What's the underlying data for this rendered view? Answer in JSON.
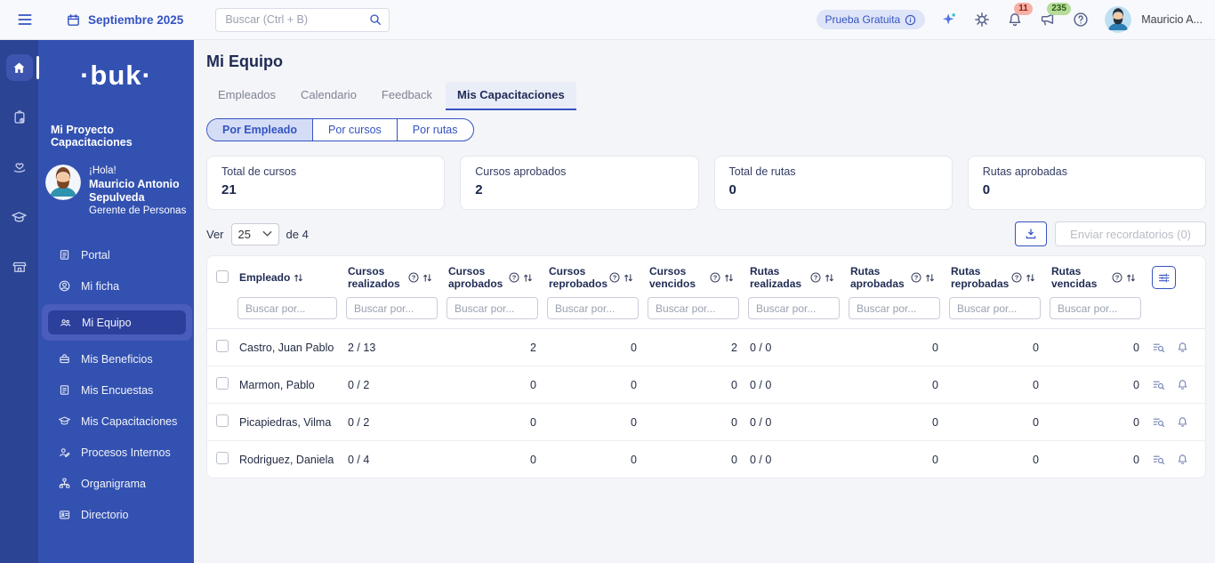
{
  "topbar": {
    "date_label": "Septiembre 2025",
    "search_placeholder": "Buscar (Ctrl + B)",
    "trial_label": "Prueba Gratuita",
    "notifications_badge": "11",
    "announcements_badge": "235",
    "user_name": "Mauricio A..."
  },
  "iconstrip": {
    "items": [
      {
        "icon": "home",
        "active": true
      },
      {
        "icon": "clipboard-tasks"
      },
      {
        "icon": "hand-heart"
      },
      {
        "icon": "graduation-cap"
      },
      {
        "icon": "storefront"
      }
    ]
  },
  "sidebar": {
    "logo_text": "·buk·",
    "project_title": "Mi Proyecto Capacitaciones",
    "greeting": "¡Hola!",
    "user_name": "Mauricio Antonio Sepulveda",
    "user_role": "Gerente de Personas",
    "items": [
      {
        "label": "Portal",
        "icon": "document"
      },
      {
        "label": "Mi ficha",
        "icon": "user-circle"
      },
      {
        "label": "Mi Equipo",
        "icon": "users",
        "active": true
      },
      {
        "label": "Mis Beneficios",
        "icon": "lunchbox"
      },
      {
        "label": "Mis Encuestas",
        "icon": "survey-document"
      },
      {
        "label": "Mis Capacitaciones",
        "icon": "graduation-cap"
      },
      {
        "label": "Procesos Internos",
        "icon": "user-edit"
      },
      {
        "label": "Organigrama",
        "icon": "org-chart"
      },
      {
        "label": "Directorio",
        "icon": "id-card"
      }
    ]
  },
  "main": {
    "title": "Mi Equipo",
    "tabs": [
      {
        "label": "Empleados"
      },
      {
        "label": "Calendario"
      },
      {
        "label": "Feedback"
      },
      {
        "label": "Mis Capacitaciones",
        "active": true
      }
    ],
    "view_pills": [
      {
        "label": "Por Empleado",
        "active": true
      },
      {
        "label": "Por cursos"
      },
      {
        "label": "Por rutas"
      }
    ],
    "summary_cards": [
      {
        "label": "Total de cursos",
        "value": "21"
      },
      {
        "label": "Cursos aprobados",
        "value": "2"
      },
      {
        "label": "Total de rutas",
        "value": "0"
      },
      {
        "label": "Rutas aprobadas",
        "value": "0"
      }
    ],
    "pagination": {
      "ver_label": "Ver",
      "page_size": "25",
      "total_label": "de 4"
    },
    "toolbar": {
      "send_reminders_label": "Enviar recordatorios (0)"
    },
    "table": {
      "filter_placeholder": "Buscar por...",
      "columns": [
        {
          "label": "Empleado"
        },
        {
          "label": "Cursos realizados"
        },
        {
          "label": "Cursos aprobados"
        },
        {
          "label": "Cursos reprobados"
        },
        {
          "label": "Cursos vencidos"
        },
        {
          "label": "Rutas realizadas"
        },
        {
          "label": "Rutas aprobadas"
        },
        {
          "label": "Rutas reprobadas"
        },
        {
          "label": "Rutas vencidas"
        }
      ],
      "rows": [
        {
          "name": "Castro, Juan Pablo",
          "cursos_realizados": "2 / 13",
          "cursos_aprobados": "2",
          "cursos_reprobados": "0",
          "cursos_vencidos": "2",
          "rutas_realizadas": "0 / 0",
          "rutas_aprobadas": "0",
          "rutas_reprobadas": "0",
          "rutas_vencidas": "0"
        },
        {
          "name": "Marmon, Pablo",
          "cursos_realizados": "0 / 2",
          "cursos_aprobados": "0",
          "cursos_reprobados": "0",
          "cursos_vencidos": "0",
          "rutas_realizadas": "0 / 0",
          "rutas_aprobadas": "0",
          "rutas_reprobadas": "0",
          "rutas_vencidas": "0"
        },
        {
          "name": "Picapiedras, Vilma",
          "cursos_realizados": "0 / 2",
          "cursos_aprobados": "0",
          "cursos_reprobados": "0",
          "cursos_vencidos": "0",
          "rutas_realizadas": "0 / 0",
          "rutas_aprobadas": "0",
          "rutas_reprobadas": "0",
          "rutas_vencidas": "0"
        },
        {
          "name": "Rodriguez, Daniela",
          "cursos_realizados": "0 / 4",
          "cursos_aprobados": "0",
          "cursos_reprobados": "0",
          "cursos_vencidos": "0",
          "rutas_realizadas": "0 / 0",
          "rutas_aprobadas": "0",
          "rutas_reprobadas": "0",
          "rutas_vencidas": "0"
        }
      ]
    }
  },
  "colors": {
    "accent_blue": "#3453c1",
    "sidebar_blue": "#3351b0",
    "strip_blue": "#2c4494",
    "selected_item_blue": "#2b3f9b",
    "highlight_panel_blue": "#4a5cbc",
    "badge_red_bg": "#f6b0a4",
    "badge_red_text": "#8f2015",
    "badge_green_bg": "#b5dc9a",
    "badge_green_text": "#2f5b13"
  }
}
